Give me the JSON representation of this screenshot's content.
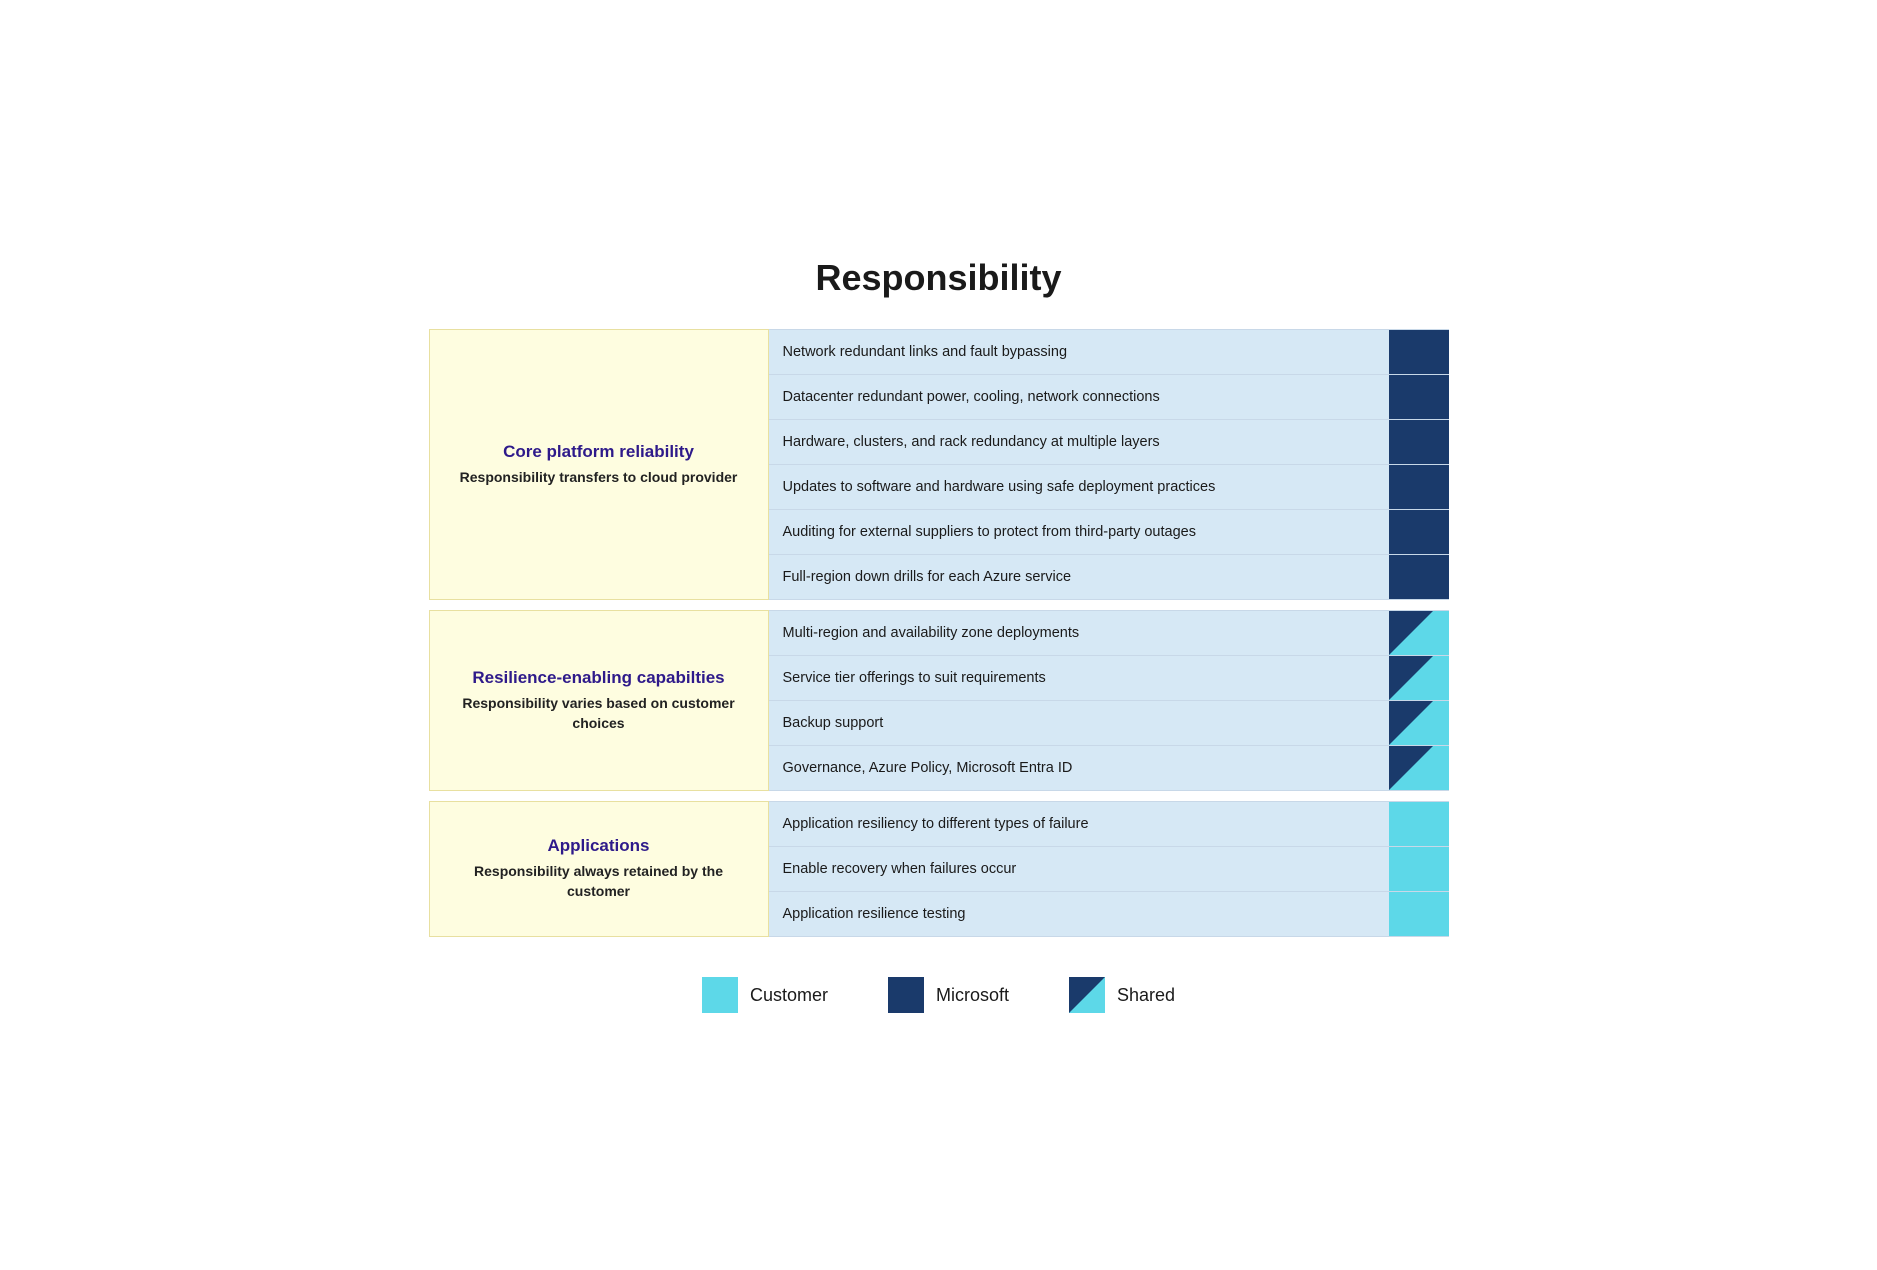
{
  "title": "Responsibility",
  "sections": [
    {
      "id": "core-platform",
      "title": "Core platform reliability",
      "subtitle": "Responsibility transfers\nto cloud provider",
      "rows": [
        {
          "text": "Network redundant links and fault bypassing",
          "indicator": "microsoft"
        },
        {
          "text": "Datacenter redundant power, cooling, network connections",
          "indicator": "microsoft"
        },
        {
          "text": "Hardware, clusters, and rack redundancy at multiple layers",
          "indicator": "microsoft"
        },
        {
          "text": "Updates to software and hardware using safe deployment practices",
          "indicator": "microsoft"
        },
        {
          "text": "Auditing for external suppliers to protect from third-party outages",
          "indicator": "microsoft"
        },
        {
          "text": "Full-region down drills for each Azure service",
          "indicator": "microsoft"
        }
      ]
    },
    {
      "id": "resilience-enabling",
      "title": "Resilience-enabling capabilties",
      "subtitle": "Responsibility varies based\non customer choices",
      "rows": [
        {
          "text": "Multi-region and availability zone deployments",
          "indicator": "shared"
        },
        {
          "text": "Service tier offerings to suit requirements",
          "indicator": "shared"
        },
        {
          "text": "Backup support",
          "indicator": "shared"
        },
        {
          "text": "Governance, Azure Policy, Microsoft Entra ID",
          "indicator": "shared"
        }
      ]
    },
    {
      "id": "applications",
      "title": "Applications",
      "subtitle": "Responsibility always\nretained by the customer",
      "rows": [
        {
          "text": "Application resiliency to different types of failure",
          "indicator": "customer"
        },
        {
          "text": "Enable recovery when failures occur",
          "indicator": "customer"
        },
        {
          "text": "Application resilience testing",
          "indicator": "customer"
        }
      ]
    }
  ],
  "legend": {
    "items": [
      {
        "id": "customer",
        "label": "Customer",
        "type": "customer"
      },
      {
        "id": "microsoft",
        "label": "Microsoft",
        "type": "microsoft"
      },
      {
        "id": "shared",
        "label": "Shared",
        "type": "shared"
      }
    ]
  }
}
